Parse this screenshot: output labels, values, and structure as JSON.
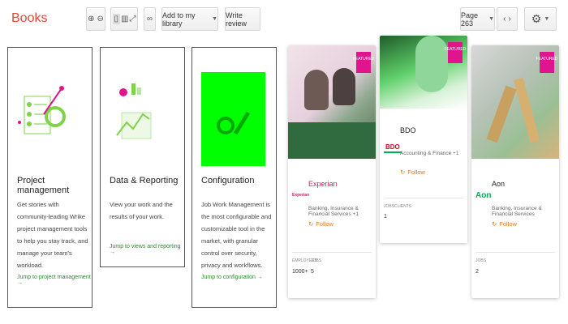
{
  "app": {
    "title": "Books"
  },
  "toolbar": {
    "add_library_label": "Add to my library",
    "write_review_label": "Write review",
    "page_label": "Page 263"
  },
  "features": [
    {
      "title": "Project management",
      "desc": "Get stories with community-leading Wrike project management tools to help you stay track, and manage your team's workload.",
      "link": "Jump to project management →"
    },
    {
      "title": "Data & Reporting",
      "desc": "View your work and the results of your work.",
      "link": "Jump to views and reporting →"
    },
    {
      "title": "Configuration",
      "desc": "Job Work Management is the most configurable and customizable tool in the market, with granular control over security, privacy and workflows.",
      "link": "Jump to configuration →"
    }
  ],
  "companies": [
    {
      "badge": "FEATURED",
      "logo": "Experian",
      "name": "Experian",
      "industry": "Banking, Insurance & Financial Services +1",
      "follow": "Follow",
      "employees_label": "EMPLOYEES",
      "employees": "1000+",
      "jobs_label": "JOBS",
      "jobs": "5",
      "logo_color": "#d81e5b"
    },
    {
      "badge": "FEATURED",
      "logo": "BDO",
      "name": "BDO",
      "industry": "Accounting & Finance +1",
      "follow": "Follow",
      "jobs_label": "JOBS",
      "jobs": "1",
      "clients_label": "CLIENTS",
      "clients": "",
      "logo_color": "#e2001a"
    },
    {
      "badge": "FEATURED",
      "logo": "Aon",
      "name": "Aon",
      "industry": "Banking, Insurance & Financial Services",
      "follow": "Follow",
      "jobs_label": "JOBS",
      "jobs": "2",
      "logo_color": "#00b050"
    }
  ],
  "colors": {
    "brand": "#dd4b39",
    "accent_green": "#00ff00",
    "badge_pink": "#e0148c",
    "follow_orange": "#e07b1a"
  },
  "icons": [
    "zoom-in-icon",
    "zoom-out-icon",
    "single-page-icon",
    "two-page-icon",
    "fullscreen-icon",
    "link-icon",
    "prev-page-icon",
    "next-page-icon",
    "settings-gear-icon"
  ]
}
